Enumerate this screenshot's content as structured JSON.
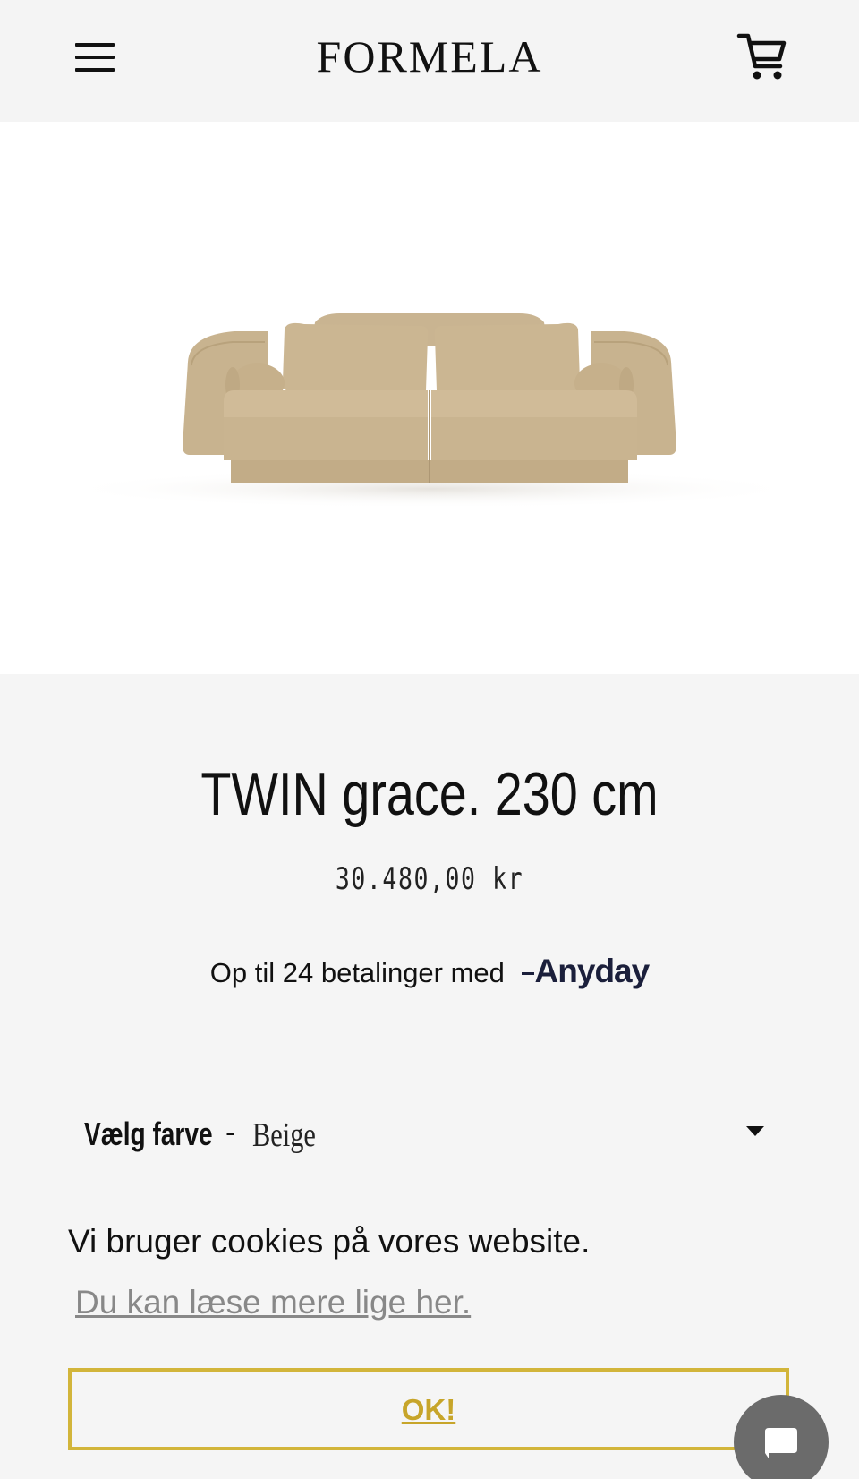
{
  "header": {
    "logo": "FORMELA",
    "menu_icon": "hamburger-menu-icon",
    "cart_icon": "shopping-cart-icon"
  },
  "hero": {
    "image": "beige-two-seat-sofa"
  },
  "product": {
    "title": "TWIN grace. 230 cm",
    "price": "30.480,00 kr"
  },
  "financing": {
    "text": "Op til 24 betalinger med",
    "provider": "Anyday"
  },
  "variant": {
    "label": "Vælg farve",
    "separator": "-",
    "value": "Beige"
  },
  "cookie_banner": {
    "message": "Vi bruger cookies på vores website.",
    "link_text": "Du kan læse mere lige her.",
    "button_label": "OK!",
    "accent_color": "#d2b53a"
  },
  "chat": {
    "icon": "chat-bubble-icon"
  }
}
